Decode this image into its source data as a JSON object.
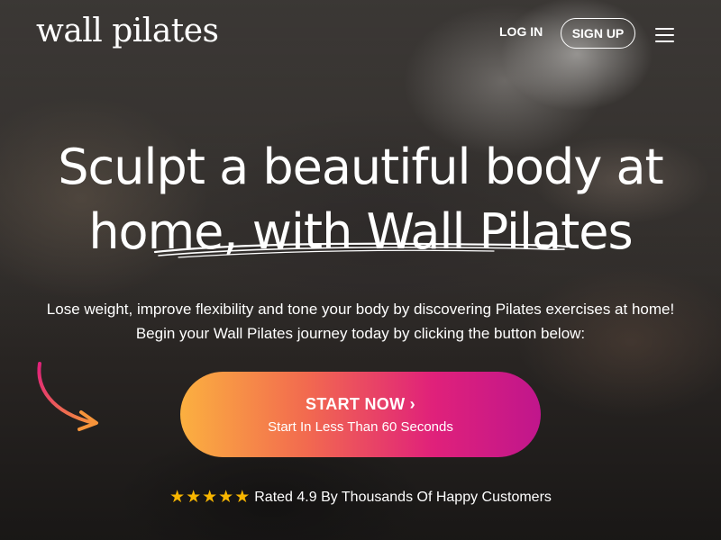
{
  "header": {
    "logo": "wall pilates",
    "login_label": "LOG IN",
    "signup_label": "SIGN UP",
    "menu_icon": "hamburger-menu-icon"
  },
  "hero": {
    "headline_line1": "Sculpt a beautiful body at",
    "headline_line2": "home, with Wall Pilates",
    "subtitle": "Lose weight, improve flexibility and tone your body by discovering Pilates exercises at home! Begin your Wall Pilates journey today by clicking the button below:"
  },
  "cta": {
    "title": "START NOW ›",
    "subtitle": "Start In Less Than 60 Seconds",
    "gradient_start": "#fbb040",
    "gradient_end": "#c0168c"
  },
  "rating": {
    "stars": "★★★★★",
    "star_count": 5,
    "star_color": "#f7b500",
    "text": "Rated 4.9 By Thousands Of Happy Customers"
  }
}
